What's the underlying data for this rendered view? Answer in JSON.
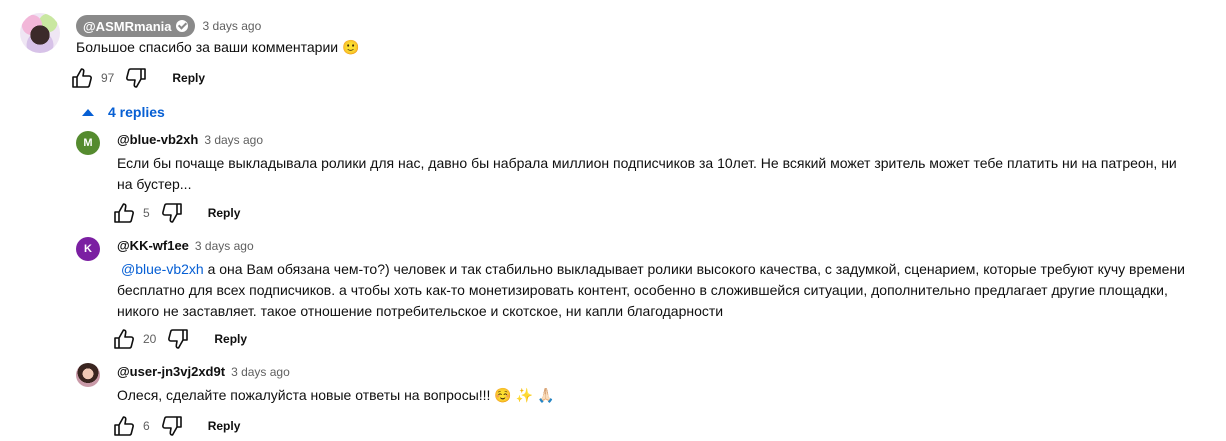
{
  "top_comment": {
    "author": "@ASMRmania",
    "time": "3 days ago",
    "text": "Большое спасибо за ваши комментарии 🙂",
    "likes": "97",
    "reply_label": "Reply"
  },
  "replies_toggle": {
    "label": "4 replies"
  },
  "replies": [
    {
      "avatar_letter": "M",
      "avatar_color": "#558b2f",
      "author": "@blue-vb2xh",
      "time": "3 days ago",
      "text_line1": "Если бы почаще выкладывала ролики для нас, давно бы набрала миллион подписчиков за 10лет. Не всякий может зритель может тебе платить ни на патреон, ни",
      "text_line2": "на бустер...",
      "likes": "5",
      "reply_label": "Reply"
    },
    {
      "avatar_letter": "K",
      "avatar_color": "#7b1fa2",
      "author": "@KK-wf1ee",
      "time": "3 days ago",
      "mention": "@blue-vb2xh",
      "text_line1": " а она Вам обязана чем-то?) человек и так стабильно выкладывает ролики высокого качества, с задумкой, сценарием, которые требуют кучу времени",
      "text_line2": "бесплатно для всех подписчиков. а чтобы хоть как-то монетизировать контент, особенно в сложившейся ситуации, дополнительно предлагает другие площадки,",
      "text_line3": "никого не заставляет. такое отношение потребительское и скотское, ни капли благодарности",
      "likes": "20",
      "reply_label": "Reply"
    },
    {
      "author": "@user-jn3vj2xd9t",
      "time": "3 days ago",
      "text": "Олеся, сделайте пожалуйста новые ответы на вопросы!!! ☺️ ✨ 🙏🏻",
      "likes": "6",
      "reply_label": "Reply"
    }
  ]
}
